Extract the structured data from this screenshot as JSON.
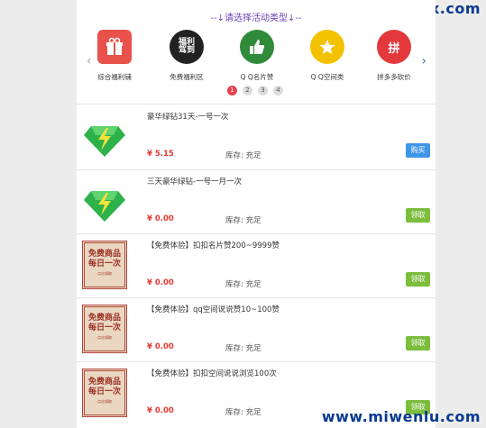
{
  "watermarks": {
    "top": "www.bsbinfx.com",
    "bottom": "www.miwenlu.com"
  },
  "category_prompt": "--↓请选择活动类型↓--",
  "categories": [
    {
      "label": "综合福利铺",
      "icon": "gift-icon"
    },
    {
      "label": "免费福利区",
      "icon": "welfare-icon",
      "text": "福利 驾到"
    },
    {
      "label": "Q Q名片赞",
      "icon": "thumbs-up-icon"
    },
    {
      "label": "Q Q空间类",
      "icon": "star-icon"
    },
    {
      "label": "拼多多砍价",
      "icon": "pinduoduo-icon",
      "text": "拼"
    }
  ],
  "pagination": [
    "1",
    "2",
    "3",
    "4"
  ],
  "items": [
    {
      "name": "豪华绿钻31天-一号一次",
      "price": "¥ 5.15",
      "stock": "库存: 充足",
      "button": "购买",
      "thumb": "green-diamond-icon"
    },
    {
      "name": "三天豪华绿钻-一号一月一次",
      "price": "¥ 0.00",
      "stock": "库存: 充足",
      "button": "领取",
      "thumb": "green-diamond-icon"
    },
    {
      "name": "【免费体验】扣扣名片赞200~9999赞",
      "price": "¥ 0.00",
      "stock": "库存: 充足",
      "button": "领取",
      "thumb": "free-stamp-icon"
    },
    {
      "name": "【免费体验】qq空间说说赞10~100赞",
      "price": "¥ 0.00",
      "stock": "库存: 充足",
      "button": "领取",
      "thumb": "free-stamp-icon"
    },
    {
      "name": "【免费体验】扣扣空间说说浏览100次",
      "price": "¥ 0.00",
      "stock": "库存: 充足",
      "button": "领取",
      "thumb": "free-stamp-icon"
    }
  ],
  "stamp": {
    "line1": "免费商品",
    "line2": "每日一次",
    "line3": "点击领取"
  },
  "colors": {
    "price": "#e53935",
    "buy": "#3f96e8",
    "get": "#7cbd3d",
    "title": "#6a3fb5"
  }
}
